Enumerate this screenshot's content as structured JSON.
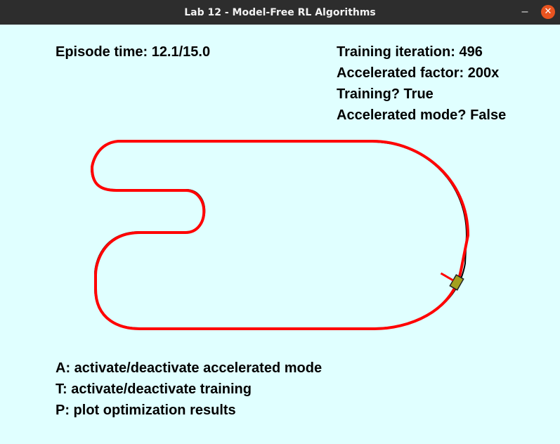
{
  "window": {
    "title": "Lab 12 - Model-Free RL Algorithms",
    "minimize_icon": "minimize-icon",
    "close_icon": "close-icon"
  },
  "hud": {
    "episode_time": "Episode time: 12.1/15.0",
    "training_iteration": "Training iteration: 496",
    "accelerated_factor": "Accelerated factor: 200x",
    "training": "Training? True",
    "accelerated_mode": "Accelerated mode? False"
  },
  "help": {
    "line_a": "A: activate/deactivate accelerated mode",
    "line_t": "T: activate/deactivate training",
    "line_p": "P: plot optimization results"
  },
  "colors": {
    "background": "#e0ffff",
    "track": "#000000",
    "trajectory": "#ff0000",
    "car": "#a3a01e"
  }
}
